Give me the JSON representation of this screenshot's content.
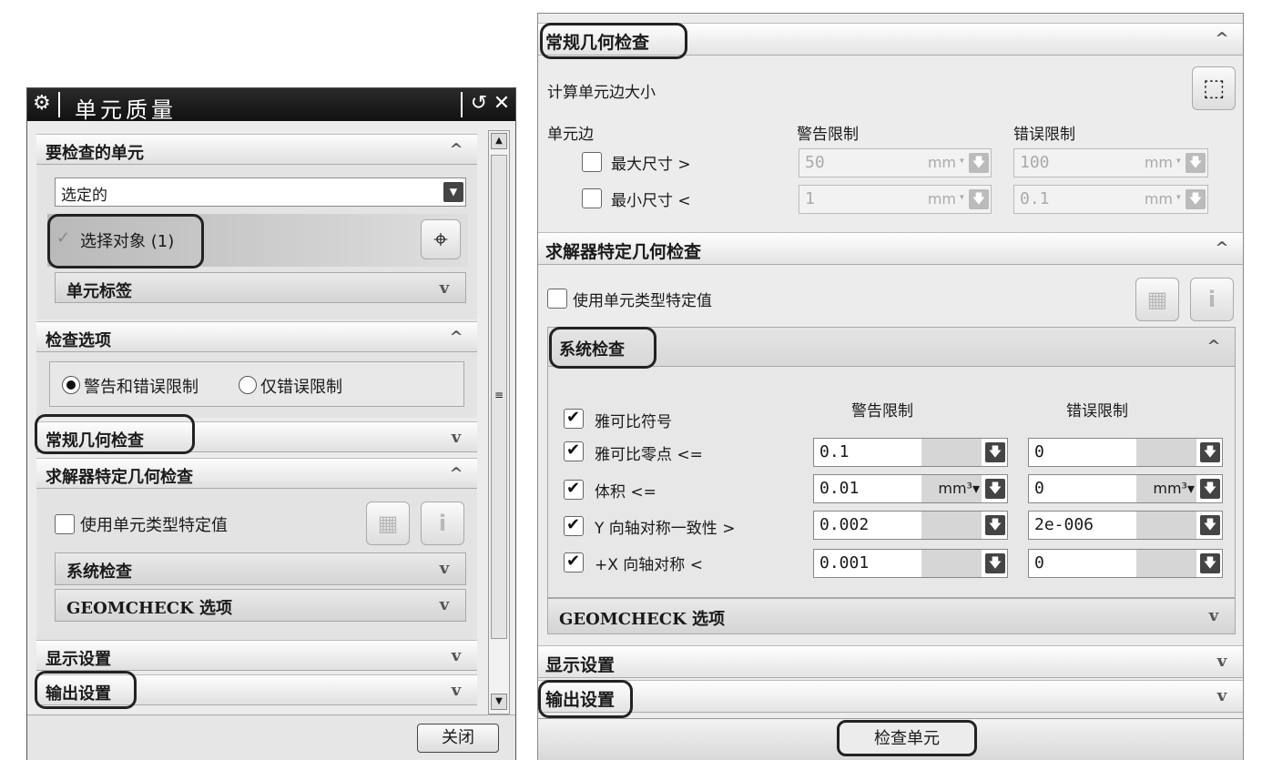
{
  "left_dialog": {
    "title": "单元质量",
    "reset_icon": "reset-icon",
    "close_icon": "close-icon",
    "sections": {
      "elements_to_check": "要检查的单元",
      "selection_type": "选定的",
      "select_objects": "选择对象 (1)",
      "element_label": "单元标签",
      "check_options": "检查选项",
      "option_warn_error": "警告和错误限制",
      "option_error_only": "仅错误限制",
      "general_geometry": "常规几何检查",
      "solver_geometry": "求解器特定几何检查",
      "use_type_values": "使用单元类型特定值",
      "system_check": "系统检查",
      "geomcheck": "GEOMCHECK 选项",
      "display_settings": "显示设置",
      "output_settings": "输出设置"
    },
    "close_button": "关闭",
    "scroll_marker": "≡"
  },
  "right_panel": {
    "general_geometry": "常规几何检查",
    "compute_edge": "计算单元边大小",
    "element_edge": "单元边",
    "warning_limit": "警告限制",
    "error_limit": "错误限制",
    "edge_rows": [
      {
        "label": "最大尺寸 >",
        "warn": "50",
        "warn_unit": "mm",
        "err": "100",
        "err_unit": "mm"
      },
      {
        "label": "最小尺寸 <",
        "warn": "1",
        "warn_unit": "mm",
        "err": "0.1",
        "err_unit": "mm"
      }
    ],
    "solver_geometry": "求解器特定几何检查",
    "use_type_values": "使用单元类型特定值",
    "system_check": "系统检查",
    "warning_limit_2": "警告限制",
    "error_limit_2": "错误限制",
    "system_rows": [
      {
        "label": "雅可比符号",
        "warn": "",
        "warn_unit": "",
        "err": "",
        "err_unit": ""
      },
      {
        "label": "雅可比零点 <=",
        "warn": "0.1",
        "warn_unit": "",
        "err": "0",
        "err_unit": ""
      },
      {
        "label": "体积 <=",
        "warn": "0.01",
        "warn_unit": "mm",
        "err": "0",
        "err_unit": "mm"
      },
      {
        "label": "Y 向轴对称一致性 >",
        "warn": "0.002",
        "warn_unit": "",
        "err": "2e-006",
        "err_unit": ""
      },
      {
        "label": "+X 向轴对称 <",
        "warn": "0.001",
        "warn_unit": "",
        "err": "0",
        "err_unit": ""
      }
    ],
    "geomcheck": "GEOMCHECK 选项",
    "display_settings": "显示设置",
    "output_settings": "输出设置",
    "check_button": "检查单元"
  },
  "colors": {
    "title_bar": "#111111",
    "panel_bg": "#ececec",
    "header_bg": "#f4f4f4",
    "highlight": "#222222"
  }
}
